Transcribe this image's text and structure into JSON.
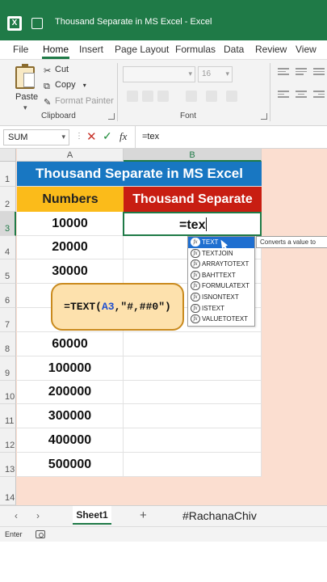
{
  "window": {
    "title": "Thousand Separate in MS Excel  -  Excel",
    "app_icon_letter": "X"
  },
  "menu": {
    "tabs": [
      "File",
      "Home",
      "Insert",
      "Page Layout",
      "Formulas",
      "Data",
      "Review",
      "View"
    ],
    "active": "Home"
  },
  "ribbon": {
    "paste_label": "Paste",
    "cut_label": "Cut",
    "copy_label": "Copy",
    "format_painter_label": "Format Painter",
    "clipboard_group_label": "Clipboard",
    "font_group_label": "Font",
    "font_size_value": "16"
  },
  "formula_bar": {
    "name_box": "SUM",
    "fx_label": "fx",
    "content": "=tex"
  },
  "grid": {
    "columns": [
      "A",
      "B"
    ],
    "selected_column": "B",
    "row_numbers": [
      "1",
      "2",
      "3",
      "4",
      "5",
      "6",
      "7",
      "8",
      "9",
      "10",
      "11",
      "12",
      "13",
      "14"
    ],
    "selected_row": "3",
    "title_text": "Thousand Separate in MS Excel",
    "header_numbers": "Numbers",
    "header_thousand": "Thousand Separate",
    "numbers": [
      "10000",
      "20000",
      "30000",
      "",
      "",
      "60000",
      "100000",
      "200000",
      "300000",
      "400000",
      "500000"
    ],
    "active_cell_text": "=tex"
  },
  "autocomplete": {
    "items": [
      "TEXT",
      "TEXTJOIN",
      "ARRAYTOTEXT",
      "BAHTTEXT",
      "FORMULATEXT",
      "ISNONTEXT",
      "ISTEXT",
      "VALUETOTEXT"
    ],
    "selected": "TEXT",
    "tooltip": "Converts a value to"
  },
  "callout": {
    "prefix": "=TEXT(",
    "ref": "A3",
    "suffix": ",\"#,##0\")"
  },
  "sheets": {
    "tabs": [
      "Sheet1"
    ],
    "active": "Sheet1",
    "handle": "#RachanaChiv"
  },
  "status": {
    "mode": "Enter"
  },
  "colors": {
    "excel_green": "#1f7a47",
    "title_blue": "#1877c2",
    "numbers_header_yellow": "#fbbb1a",
    "thousand_header_red": "#c81e12",
    "background_peach": "#fbded0",
    "callout_fill": "#fde1ad"
  }
}
